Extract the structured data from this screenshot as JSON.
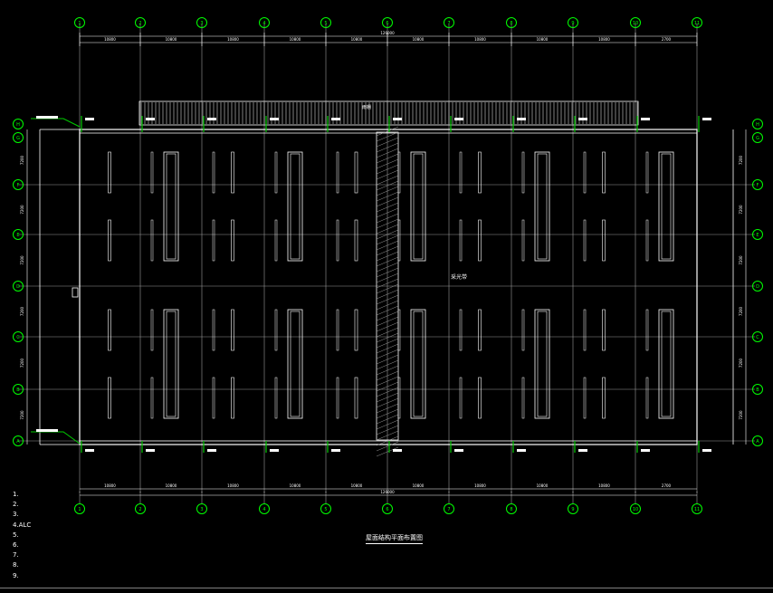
{
  "drawing": {
    "title": "屋面结构平面布置图",
    "total_dimension": "126000",
    "center_label": "采光带",
    "canopy_label": "雨棚",
    "colors": {
      "background": "#000000",
      "lines": "#ffffff",
      "axis_bubbles": "#00ff00",
      "annotation_green": "#00cc00",
      "grid_gray": "#9a9a9a"
    }
  },
  "axes": {
    "columns": [
      "1",
      "2",
      "3",
      "4",
      "5",
      "6",
      "7",
      "8",
      "9",
      "10",
      "11"
    ],
    "rows": [
      "A",
      "B",
      "C",
      "D",
      "E",
      "F",
      "G",
      "H"
    ]
  },
  "dimensions": {
    "top": [
      "2700",
      "10800",
      "10800",
      "10800",
      "10800",
      "10800",
      "10800",
      "10800",
      "10800",
      "10800",
      "2700"
    ],
    "side": [
      "7200",
      "7200",
      "7200",
      "7200",
      "7200",
      "7200",
      "7200"
    ]
  },
  "notes": [
    "1.",
    "2.",
    "3.",
    "4.ALC",
    "5.",
    "6.",
    "7.",
    "8.",
    "9."
  ]
}
